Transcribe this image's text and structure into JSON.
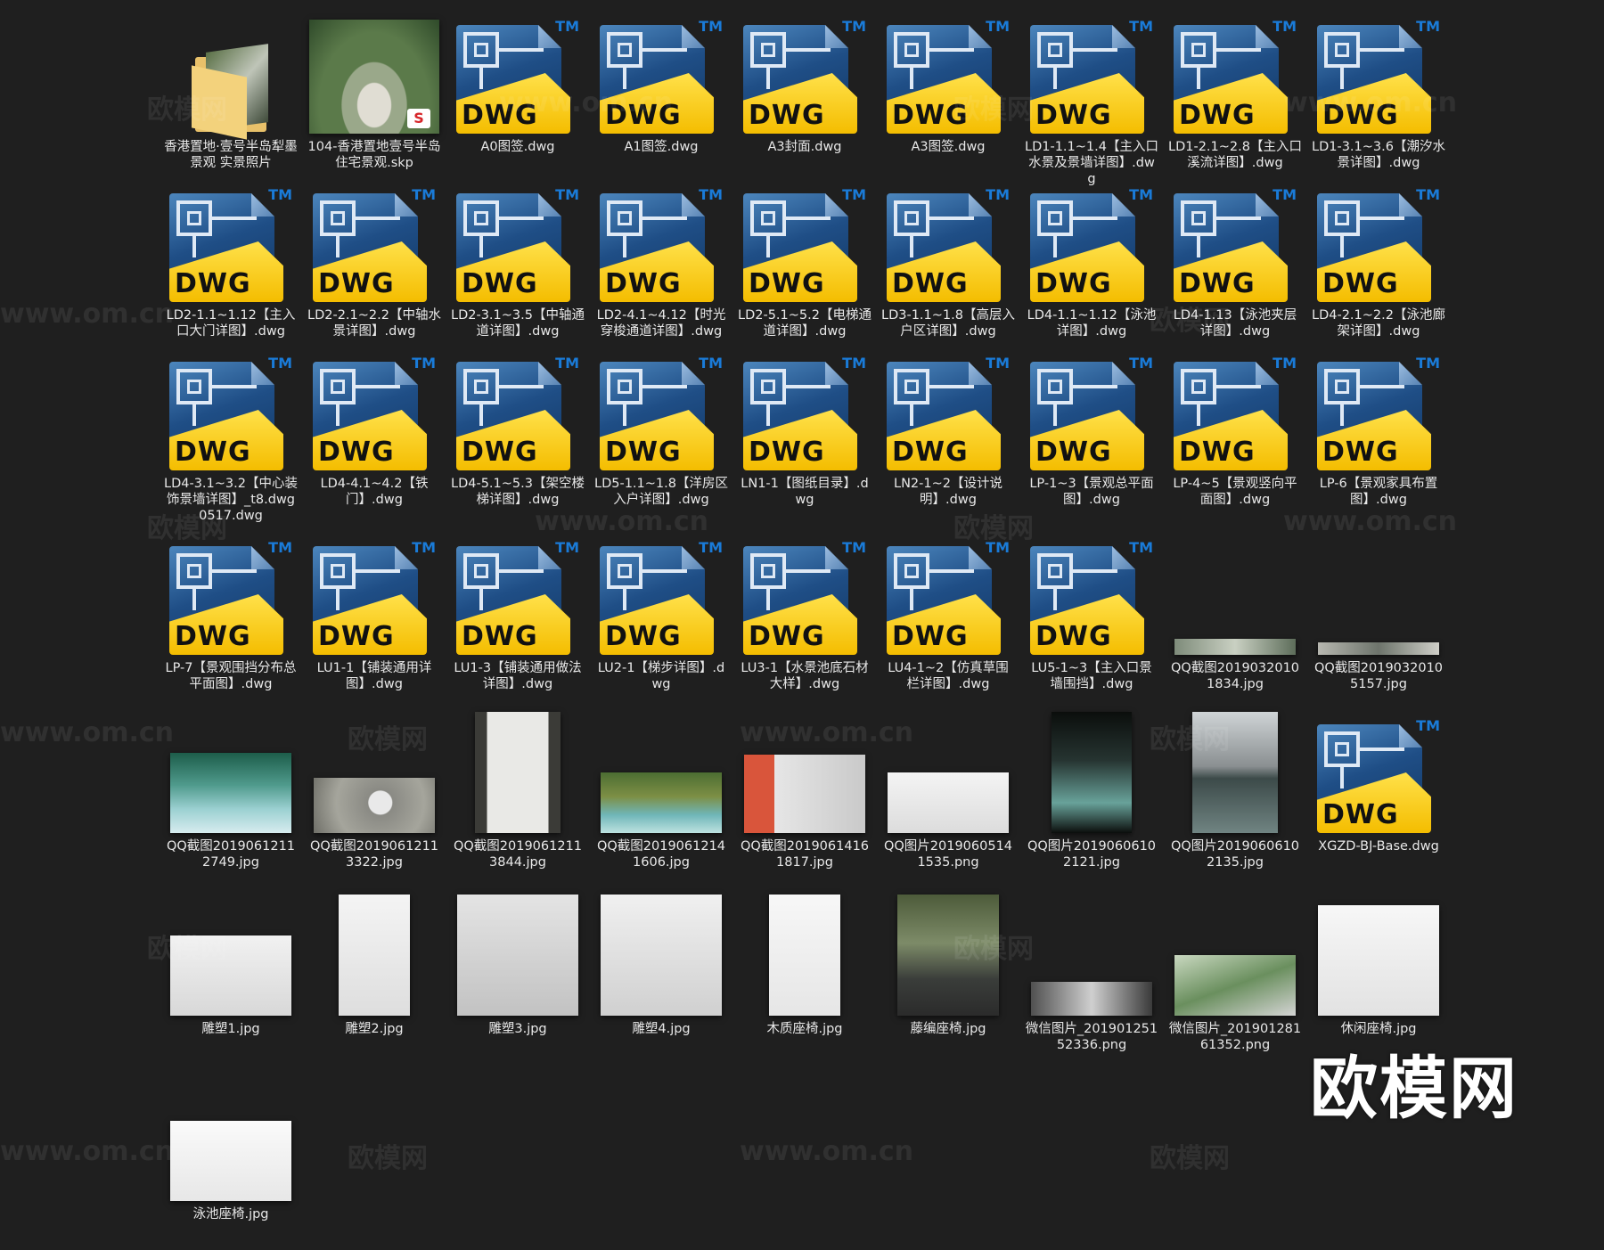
{
  "watermark": {
    "logo": "欧模网",
    "site": "www.om.cn"
  },
  "colors": {
    "background": "#1f1f1f",
    "label": "#e8e8e8",
    "dwg_blue": "#1f4e86",
    "dwg_yellow": "#f4bd00",
    "tm": "#1a7bd8"
  },
  "files": [
    {
      "name": "香港置地·壹号半岛犁墨景观 实景照片",
      "type": "folder"
    },
    {
      "name": "104-香港置地壹号半岛住宅景观.skp",
      "type": "skp"
    },
    {
      "name": "A0图签.dwg",
      "type": "dwg"
    },
    {
      "name": "A1图签.dwg",
      "type": "dwg"
    },
    {
      "name": "A3封面.dwg",
      "type": "dwg"
    },
    {
      "name": "A3图签.dwg",
      "type": "dwg"
    },
    {
      "name": "LD1-1.1~1.4【主入口水景及景墙详图】.dwg",
      "type": "dwg"
    },
    {
      "name": "LD1-2.1~2.8【主入口溪流详图】.dwg",
      "type": "dwg"
    },
    {
      "name": "LD1-3.1~3.6【潮汐水景详图】.dwg",
      "type": "dwg"
    },
    {
      "name": "LD2-1.1~1.12【主入口大门详图】.dwg",
      "type": "dwg"
    },
    {
      "name": "LD2-2.1~2.2【中轴水景详图】.dwg",
      "type": "dwg"
    },
    {
      "name": "LD2-3.1~3.5【中轴通道详图】.dwg",
      "type": "dwg"
    },
    {
      "name": "LD2-4.1~4.12【时光穿梭通道详图】.dwg",
      "type": "dwg"
    },
    {
      "name": "LD2-5.1~5.2【电梯通道详图】.dwg",
      "type": "dwg"
    },
    {
      "name": "LD3-1.1~1.8【高层入户区详图】.dwg",
      "type": "dwg"
    },
    {
      "name": "LD4-1.1~1.12【泳池详图】.dwg",
      "type": "dwg"
    },
    {
      "name": "LD4-1.13【泳池夹层详图】.dwg",
      "type": "dwg"
    },
    {
      "name": "LD4-2.1~2.2【泳池廊架详图】.dwg",
      "type": "dwg"
    },
    {
      "name": "LD4-3.1~3.2【中心装饰景墙详图】_t8.dwg0517.dwg",
      "type": "dwg"
    },
    {
      "name": "LD4-4.1~4.2【铁门】.dwg",
      "type": "dwg"
    },
    {
      "name": "LD4-5.1~5.3【架空楼梯详图】.dwg",
      "type": "dwg"
    },
    {
      "name": "LD5-1.1~1.8【洋房区入户详图】.dwg",
      "type": "dwg"
    },
    {
      "name": "LN1-1【图纸目录】.dwg",
      "type": "dwg"
    },
    {
      "name": "LN2-1~2【设计说明】.dwg",
      "type": "dwg"
    },
    {
      "name": "LP-1~3【景观总平面图】.dwg",
      "type": "dwg"
    },
    {
      "name": "LP-4~5【景观竖向平面图】.dwg",
      "type": "dwg"
    },
    {
      "name": "LP-6【景观家具布置图】.dwg",
      "type": "dwg"
    },
    {
      "name": "LP-7【景观围挡分布总平面图】.dwg",
      "type": "dwg"
    },
    {
      "name": "LU1-1【铺装通用详图】.dwg",
      "type": "dwg"
    },
    {
      "name": "LU1-3【铺装通用做法详图】.dwg",
      "type": "dwg"
    },
    {
      "name": "LU2-1【梯步详图】.dwg",
      "type": "dwg"
    },
    {
      "name": "LU3-1【水景池底石材大样】.dwg",
      "type": "dwg"
    },
    {
      "name": "LU4-1~2【仿真草围栏详图】.dwg",
      "type": "dwg"
    },
    {
      "name": "LU5-1~3【主入口景墙围挡】.dwg",
      "type": "dwg"
    },
    {
      "name": "QQ截图20190320101834.jpg",
      "type": "img",
      "w": 136,
      "h": 18,
      "bg": "linear-gradient(90deg,#7e8b7a,#c9d0c2,#5d6d5a)"
    },
    {
      "name": "QQ截图20190320105157.jpg",
      "type": "img",
      "w": 136,
      "h": 14,
      "bg": "linear-gradient(90deg,#b7b7b0,#6d746b,#cfcfc8)"
    },
    {
      "name": "QQ截图20190612112749.jpg",
      "type": "img",
      "w": 136,
      "h": 90,
      "bg": "linear-gradient(180deg,#1d5d4a 0%,#4f9a8c 40%,#9bd0d1 70%,#d7ecef 100%)"
    },
    {
      "name": "QQ截图20190612113322.jpg",
      "type": "img",
      "w": 136,
      "h": 62,
      "bg": "radial-gradient(circle at 55% 45%,#e9e9e9 0 13px,#8a8a84 14px,#a5a59c 60%,#6f6f68 100%)"
    },
    {
      "name": "QQ截图20190612113844.jpg",
      "type": "img",
      "w": 96,
      "h": 136,
      "bg": "linear-gradient(90deg,#3b3b37 0 14%,#e9e9e6 14% 86%,#3b3b37 86%)"
    },
    {
      "name": "QQ截图20190612141606.jpg",
      "type": "img",
      "w": 136,
      "h": 68,
      "bg": "linear-gradient(180deg,#4c6d32 0%,#7d8f45 40%,#6fb6b8 70%,#bde2e0 100%)"
    },
    {
      "name": "QQ截图20190614161817.jpg",
      "type": "img",
      "w": 136,
      "h": 88,
      "bg": "linear-gradient(90deg,#d9553b 0 25%,#e6e6e6 25%,#c9c9c9 100%)"
    },
    {
      "name": "QQ图片20190605141535.png",
      "type": "img",
      "w": 136,
      "h": 68,
      "bg": "linear-gradient(180deg,#f4f4f4,#dcdcdc)"
    },
    {
      "name": "QQ图片20190606102121.jpg",
      "type": "img",
      "w": 90,
      "h": 136,
      "bg": "linear-gradient(180deg,#0b0e0c,#263431 40%,#68a29a 75%,#0b0e0c)"
    },
    {
      "name": "QQ图片20190606102135.jpg",
      "type": "img",
      "w": 96,
      "h": 136,
      "bg": "linear-gradient(180deg,#cfd4d6 0%,#8a8f91 45%,#3c4a49 55%,#708482 100%)"
    },
    {
      "name": "XGZD-BJ-Base.dwg",
      "type": "dwg"
    },
    {
      "name": "雕塑1.jpg",
      "type": "img",
      "w": 136,
      "h": 90,
      "bg": "linear-gradient(180deg,#f1f1f1,#d8d8d8)"
    },
    {
      "name": "雕塑2.jpg",
      "type": "img",
      "w": 80,
      "h": 136,
      "bg": "linear-gradient(180deg,#f4f4f4,#dedede)"
    },
    {
      "name": "雕塑3.jpg",
      "type": "img",
      "w": 136,
      "h": 136,
      "bg": "linear-gradient(180deg,#e4e4e4,#c2c2c2)"
    },
    {
      "name": "雕塑4.jpg",
      "type": "img",
      "w": 136,
      "h": 136,
      "bg": "linear-gradient(180deg,#f0f0f0,#d0d0d0)"
    },
    {
      "name": "木质座椅.jpg",
      "type": "img",
      "w": 80,
      "h": 136,
      "bg": "linear-gradient(180deg,#f7f7f7,#e6e6e6)"
    },
    {
      "name": "藤编座椅.jpg",
      "type": "img",
      "w": 114,
      "h": 136,
      "bg": "linear-gradient(180deg,#4d5b3a 0%,#7d8b68 40%,#3a3d3a 70%,#2b2b2b 100%)"
    },
    {
      "name": "微信图片_20190125152336.png",
      "type": "img",
      "w": 136,
      "h": 38,
      "bg": "linear-gradient(90deg,#505050,#cfcfcf,#3a3a3a)"
    },
    {
      "name": "微信图片_20190128161352.png",
      "type": "img",
      "w": 136,
      "h": 68,
      "bg": "linear-gradient(160deg,#c9d8c0,#6a8f5e 50%,#d4d4d4)"
    },
    {
      "name": "休闲座椅.jpg",
      "type": "img",
      "w": 136,
      "h": 124,
      "bg": "linear-gradient(180deg,#f7f7f7,#e2e2e2)"
    },
    {
      "name": "泳池座椅.jpg",
      "type": "img",
      "w": 136,
      "h": 90,
      "bg": "linear-gradient(180deg,#fafafa,#e7e7e7)"
    }
  ]
}
